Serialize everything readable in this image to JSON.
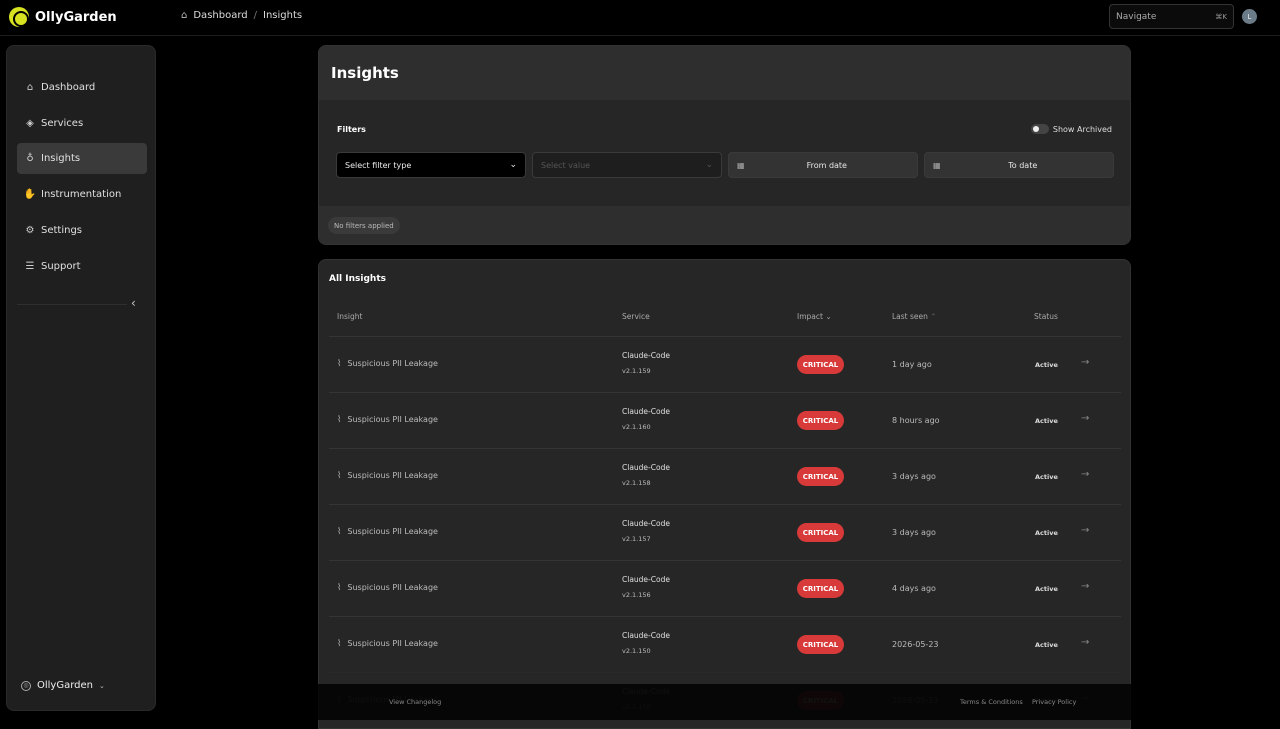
{
  "brand": {
    "name": "OllyGarden"
  },
  "breadcrumb": {
    "home": "Dashboard",
    "separator": "/",
    "current": "Insights"
  },
  "navigate": {
    "placeholder": "Navigate",
    "shortcut": "⌘K"
  },
  "user": {
    "initial": "L"
  },
  "sidebar": {
    "items": [
      {
        "label": "Dashboard",
        "icon": "home-icon"
      },
      {
        "label": "Services",
        "icon": "layers-icon"
      },
      {
        "label": "Insights",
        "icon": "lightbulb-icon",
        "active": true
      },
      {
        "label": "Instrumentation",
        "icon": "hand-icon"
      },
      {
        "label": "Settings",
        "icon": "gear-icon"
      },
      {
        "label": "Support",
        "icon": "support-icon"
      }
    ],
    "org": "OllyGarden"
  },
  "page": {
    "title": "Insights"
  },
  "filters": {
    "title": "Filters",
    "show_archived": "Show Archived",
    "filter_type_placeholder": "Select filter type",
    "value_placeholder": "Select value",
    "from_date": "From date",
    "to_date": "To date",
    "applied": "No filters applied"
  },
  "insights": {
    "title": "All Insights",
    "columns": {
      "insight": "Insight",
      "service": "Service",
      "impact": "Impact",
      "last_seen": "Last seen",
      "status": "Status"
    },
    "rows": [
      {
        "name": "Suspicious PII Leakage",
        "service": "Claude-Code",
        "version": "v2.1.159",
        "impact": "CRITICAL",
        "last_seen": "1 day ago",
        "status": "Active"
      },
      {
        "name": "Suspicious PII Leakage",
        "service": "Claude-Code",
        "version": "v2.1.160",
        "impact": "CRITICAL",
        "last_seen": "8 hours ago",
        "status": "Active"
      },
      {
        "name": "Suspicious PII Leakage",
        "service": "Claude-Code",
        "version": "v2.1.158",
        "impact": "CRITICAL",
        "last_seen": "3 days ago",
        "status": "Active"
      },
      {
        "name": "Suspicious PII Leakage",
        "service": "Claude-Code",
        "version": "v2.1.157",
        "impact": "CRITICAL",
        "last_seen": "3 days ago",
        "status": "Active"
      },
      {
        "name": "Suspicious PII Leakage",
        "service": "Claude-Code",
        "version": "v2.1.156",
        "impact": "CRITICAL",
        "last_seen": "4 days ago",
        "status": "Active"
      },
      {
        "name": "Suspicious PII Leakage",
        "service": "Claude-Code",
        "version": "v2.1.150",
        "impact": "CRITICAL",
        "last_seen": "2026-05-23",
        "status": "Active"
      }
    ]
  },
  "footer": {
    "changelog": "View Changelog",
    "terms": "Terms & Conditions",
    "privacy": "Privacy Policy"
  },
  "colors": {
    "critical": "#d83a3a",
    "brand": "#d6e21f"
  }
}
